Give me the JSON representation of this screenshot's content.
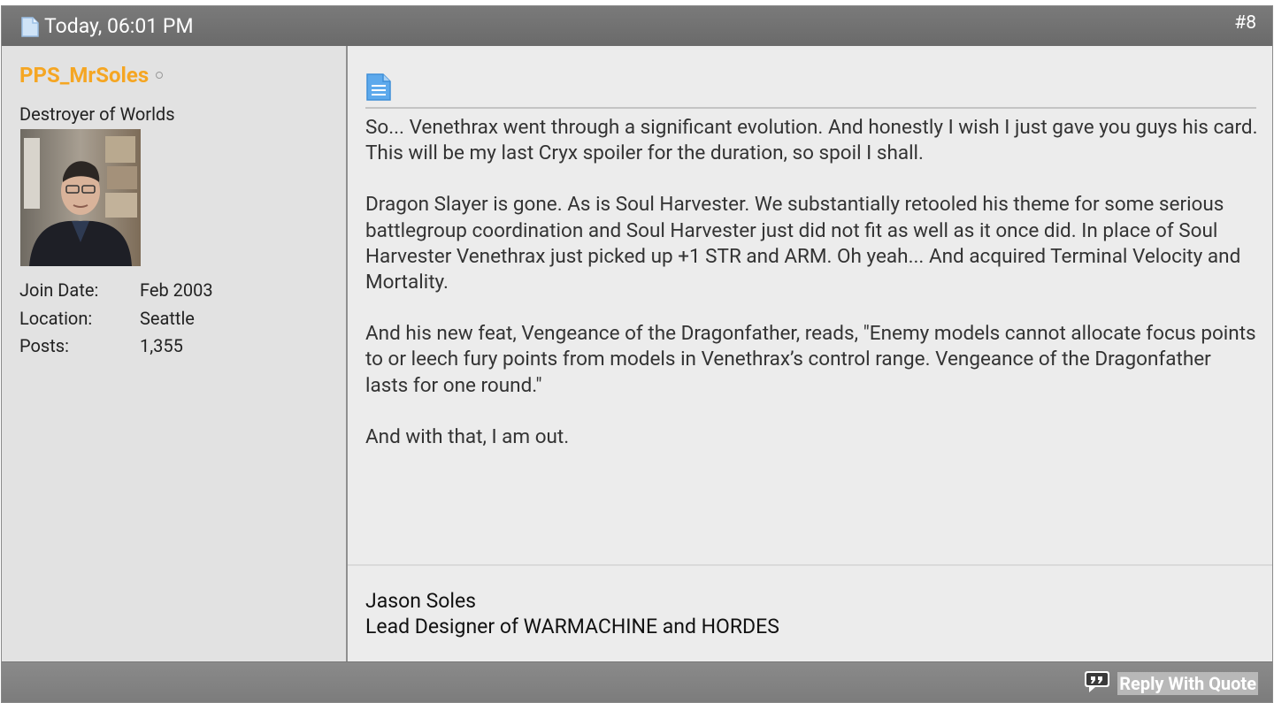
{
  "header": {
    "date": "Today, 06:01 PM",
    "post_number": "#8"
  },
  "user": {
    "username": "PPS_MrSoles",
    "status": "offline",
    "title": "Destroyer of Worlds",
    "stats": [
      {
        "label": "Join Date:",
        "value": "Feb 2003"
      },
      {
        "label": "Location:",
        "value": "Seattle"
      },
      {
        "label": "Posts:",
        "value": "1,355"
      }
    ]
  },
  "message": {
    "paragraphs": [
      "So... Venethrax went through a significant evolution. And honestly I wish I just gave you guys his card. This will be my last Cryx spoiler for the duration, so spoil I shall.",
      "Dragon Slayer is gone. As is Soul Harvester. We substantially retooled his theme for some serious battlegroup coordination and Soul Harvester just did not fit as well as it once did. In place of Soul Harvester Venethrax just picked up +1 STR and ARM. Oh yeah... And acquired Terminal Velocity and Mortality.",
      "And his new feat, Vengeance of the Dragonfather, reads, \"Enemy models cannot allocate focus points to or leech fury points from models in Venethrax’s control range. Vengeance of the Dragonfather lasts for one round.\"",
      "And with that, I am out."
    ]
  },
  "signature": {
    "line1": "Jason Soles",
    "line2": "Lead Designer of WARMACHINE and HORDES"
  },
  "footer": {
    "reply_with_quote": "Reply With Quote"
  },
  "colors": {
    "username": "#f5a623",
    "header_bg": "#737373",
    "sidebar_bg": "#e2e2e2",
    "content_bg": "#ececec"
  }
}
